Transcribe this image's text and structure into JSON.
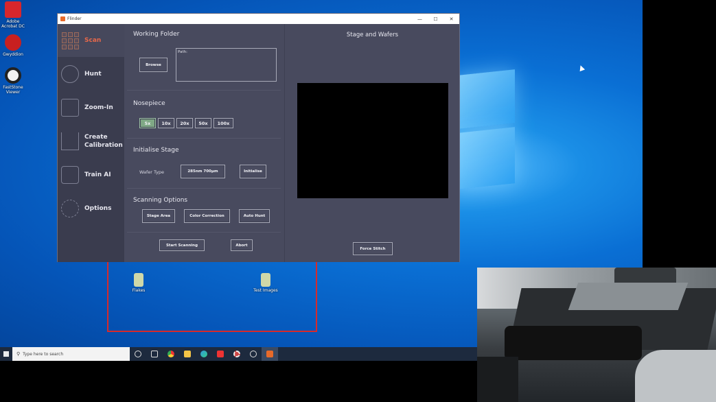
{
  "desktop": {
    "icons": [
      {
        "label": "Adobe Acrobat DC",
        "color": "#d8262c"
      },
      {
        "label": "Gwyddion",
        "color": "#c82020"
      },
      {
        "label": "FastStone Viewer",
        "color": "#f2f2f2"
      }
    ],
    "folder_icons": [
      {
        "label": "Flakes",
        "color": "#cfd8a8"
      },
      {
        "label": "Test Images",
        "color": "#cfd8a8"
      }
    ]
  },
  "window": {
    "title": "Flinder",
    "controls": {
      "minimize": "—",
      "maximize": "☐",
      "close": "✕"
    }
  },
  "sidebar": {
    "items": [
      {
        "label": "Scan",
        "icon": "grid-icon",
        "active": true
      },
      {
        "label": "Hunt",
        "icon": "crosshair-icon",
        "active": false
      },
      {
        "label": "Zoom-In",
        "icon": "telescope-icon",
        "active": false
      },
      {
        "label": "Create Calibration",
        "icon": "compass-icon",
        "active": false
      },
      {
        "label": "Train AI",
        "icon": "robot-icon",
        "active": false
      },
      {
        "label": "Options",
        "icon": "gear-icon",
        "active": false
      }
    ]
  },
  "panel": {
    "working_folder": {
      "title": "Working Folder",
      "browse_label": "Browse",
      "path_label": "Path:"
    },
    "nosepiece": {
      "title": "Nosepiece",
      "options": [
        "5x",
        "10x",
        "20x",
        "50x",
        "100x"
      ],
      "selected": "5x"
    },
    "initialise_stage": {
      "title": "Initialise Stage",
      "wafer_type_label": "Wafer Type",
      "wafer_type_value": "285nm 700µm",
      "initialise_label": "Initialise"
    },
    "scanning_options": {
      "title": "Scanning Options",
      "stage_area_label": "Stage Area",
      "color_correction_label": "Color Correction",
      "auto_hunt_label": "Auto Hunt"
    },
    "start_scanning_label": "Start Scanning",
    "abort_label": "Abort"
  },
  "stage": {
    "title": "Stage and Wafers",
    "force_stitch_label": "Force Stitch"
  },
  "taskbar": {
    "search_placeholder": "Type here to search",
    "apps": [
      "task-view-icon",
      "widgets-icon",
      "chrome-icon",
      "file-explorer-icon",
      "edge-icon",
      "recorder-icon",
      "settings-icon",
      "clock-icon",
      "flinder-icon"
    ]
  },
  "colors": {
    "accent": "#e8684a",
    "selected_objective": "#7fa885",
    "window_bg": "#44465a"
  }
}
